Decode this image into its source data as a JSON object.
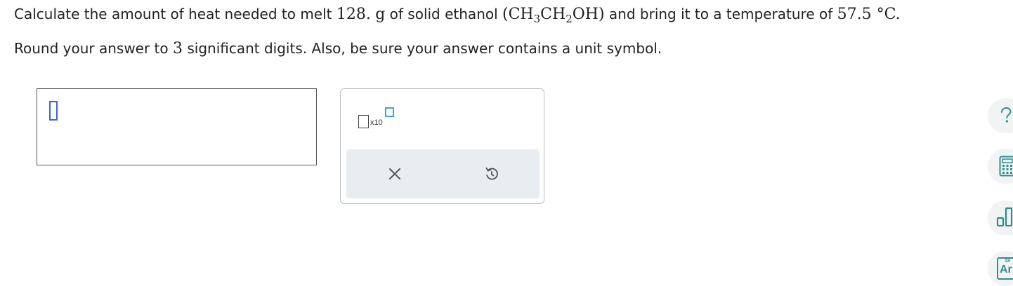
{
  "question": {
    "line1_prefix": "Calculate the amount of heat needed to melt ",
    "mass_value": "128.",
    "mass_unit": "g",
    "line1_middle": " of solid ethanol ",
    "formula_open": "(CH",
    "formula_sub1": "3",
    "formula_mid": "CH",
    "formula_sub2": "2",
    "formula_close": "OH)",
    "line1_suffix": " and bring it to a temperature of ",
    "temperature": "57.5 °C.",
    "line2_prefix": "Round your answer to ",
    "sig_digits": "3",
    "line2_suffix": " significant digits. Also, be sure your answer contains a unit symbol."
  },
  "answer": {
    "value": ""
  },
  "palette": {
    "sci_notation_label": "x10",
    "clear_icon": "close-x-icon",
    "undo_icon": "undo-icon"
  },
  "side_tools": {
    "help_icon": "question-mark-icon",
    "calculator_icon": "calculator-icon",
    "data_icon": "bar-chart-icon",
    "periodic_table_icon": "periodic-table-icon",
    "periodic_table_number": "18",
    "periodic_table_letter": "Ar"
  },
  "colors": {
    "cursor_blue": "#3d63dd",
    "exponent_blue": "#3aa6d6",
    "tool_icon_green": "#2f8f8b",
    "action_bar_bg": "#e9edf1"
  }
}
